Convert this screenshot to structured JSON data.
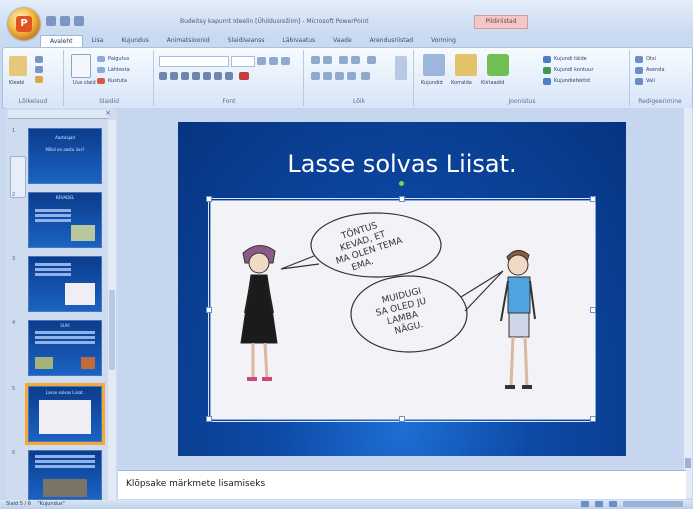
{
  "window": {
    "title": "Budeitsy kapurnt Ideelin [Ühildusrežiim] - Microsoft PowerPoint",
    "context_tab": "Pildiriistad",
    "office_button": "office-button"
  },
  "ribbon": {
    "tabs": [
      {
        "label": "Avaleht",
        "active": true
      },
      {
        "label": "Lisa"
      },
      {
        "label": "Kujundus"
      },
      {
        "label": "Animatsioonid"
      },
      {
        "label": "Slaidiseanss"
      },
      {
        "label": "Läbivaatus"
      },
      {
        "label": "Vaade"
      },
      {
        "label": "Arendusriistad"
      },
      {
        "label": "Vorming"
      }
    ],
    "groups": {
      "clipboard": {
        "label": "Lõikelaud",
        "paste": "Kleebi"
      },
      "slides": {
        "label": "Slaidid",
        "new_slide": "Uus slaid",
        "layout": "Paigutus",
        "reset": "Lähtesta",
        "delete": "Kustuta"
      },
      "font": {
        "label": "Font"
      },
      "paragraph": {
        "label": "Lõik"
      },
      "drawing": {
        "label": "Joonistus",
        "shapes": "Kujundid",
        "arrange": "Korralda",
        "quick_styles": "Kiirlaadid",
        "fill": "Kujundi täide",
        "outline": "Kujundi kontuur",
        "effects": "Kujundiefektid"
      },
      "editing": {
        "label": "Redigeerimine",
        "find": "Otsi",
        "replace": "Asenda",
        "select": "Vali"
      }
    }
  },
  "thumbnails": [
    {
      "num": "1",
      "title": "Aastaajad",
      "sub": "Millal on aasta ilus?"
    },
    {
      "num": "2",
      "title": "KEVADEL"
    },
    {
      "num": "3",
      "title": ""
    },
    {
      "num": "4",
      "title": "SUVI"
    },
    {
      "num": "5",
      "title": "Lasse solvas Liisat.",
      "selected": true
    },
    {
      "num": "6",
      "title": ""
    }
  ],
  "slide": {
    "title": "Lasse solvas Liisat.",
    "bubble_left": [
      "TÕNTUS",
      "KEVAD, ET",
      "MA OLEN TEMA",
      "EMA."
    ],
    "bubble_right": [
      "MUIDUGI",
      "SA OLED JU",
      "LAMBA",
      "NÄGU."
    ]
  },
  "notes": {
    "placeholder": "Klõpsake märkmete lisamiseks"
  },
  "status": {
    "slide_info": "Slaid 5 / 6",
    "theme": "\"Kujundus\""
  }
}
